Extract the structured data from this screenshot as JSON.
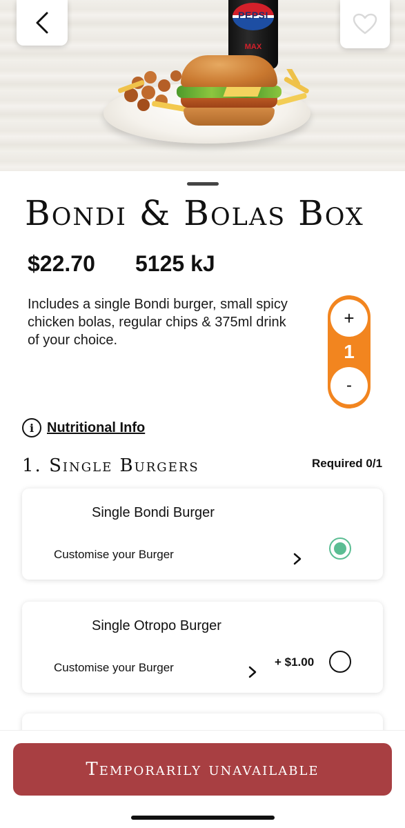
{
  "hero": {
    "can_brand": "PEPSI",
    "can_variant": "MAX",
    "back_icon": "chevron-left-icon",
    "favorite_icon": "heart-outline-icon"
  },
  "product": {
    "title": "Bondi & Bolas Box",
    "price": "$22.70",
    "energy": "5125 kJ",
    "description": "Includes a single Bondi burger, small spicy chicken bolas, regular chips & 375ml drink of your choice."
  },
  "quantity": {
    "plus_label": "+",
    "value": "1",
    "minus_label": "-"
  },
  "nutrition": {
    "icon_label": "i",
    "label": "Nutritional Info"
  },
  "section": {
    "title": "1. Single Burgers",
    "required": "Required 0/1"
  },
  "options": [
    {
      "name": "Single Bondi Burger",
      "customise": "Customise your Burger",
      "extra": "",
      "selected": true
    },
    {
      "name": "Single Otropo Burger",
      "customise": "Customise your Burger",
      "extra": "+ $1.00",
      "selected": false
    }
  ],
  "cta": {
    "label": "Temporarily unavailable"
  },
  "colors": {
    "accent_orange": "#f2851f",
    "cta_red": "#a83f42",
    "radio_green": "#5bbd93"
  }
}
